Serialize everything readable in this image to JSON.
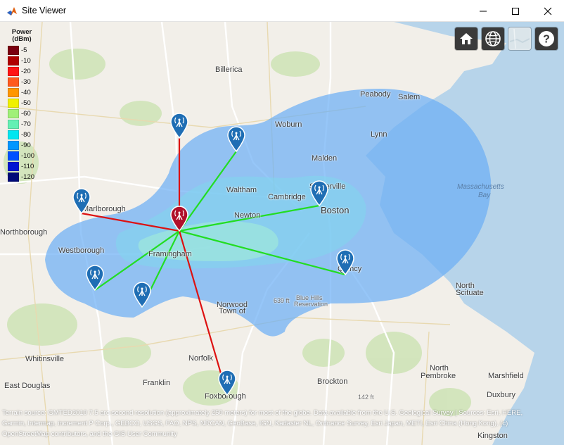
{
  "window": {
    "title": "Site Viewer",
    "app_icon": "matlab-icon",
    "buttons": [
      "minimize-icon",
      "maximize-icon",
      "close-icon"
    ]
  },
  "legend": {
    "title": "Power",
    "units": "(dBm)",
    "entries": [
      {
        "label": "-5",
        "color": "#7a0010"
      },
      {
        "label": "-10",
        "color": "#b00000"
      },
      {
        "label": "-20",
        "color": "#ff1414"
      },
      {
        "label": "-30",
        "color": "#ff5a1e"
      },
      {
        "label": "-40",
        "color": "#ff9600"
      },
      {
        "label": "-50",
        "color": "#f0f000"
      },
      {
        "label": "-60",
        "color": "#a0f078"
      },
      {
        "label": "-70",
        "color": "#64f0b4"
      },
      {
        "label": "-80",
        "color": "#00e6f0"
      },
      {
        "label": "-90",
        "color": "#0096ff"
      },
      {
        "label": "-100",
        "color": "#0050ff"
      },
      {
        "label": "-110",
        "color": "#0014d2"
      },
      {
        "label": "-120",
        "color": "#000a78"
      }
    ]
  },
  "controls": {
    "home": "home-icon",
    "globe": "globe-icon",
    "basemap": "basemap-icon",
    "help": "help-icon"
  },
  "colors": {
    "transmitter": "#b0102a",
    "receiver": "#1f6eb4",
    "link_success": "#22dd22",
    "link_failure": "#dd1111",
    "coverage_outer": "#6aaef5",
    "coverage_inner": "#8fe8e0"
  },
  "places": [
    {
      "name": "Billerica",
      "cls": "city"
    },
    {
      "name": "Peabody",
      "cls": "city"
    },
    {
      "name": "Salem",
      "cls": "city"
    },
    {
      "name": "Woburn",
      "cls": "city"
    },
    {
      "name": "Lynn",
      "cls": "city"
    },
    {
      "name": "Malden",
      "cls": "city"
    },
    {
      "name": "Somerville",
      "cls": "city"
    },
    {
      "name": "Waltham",
      "cls": "city"
    },
    {
      "name": "Cambridge",
      "cls": "city"
    },
    {
      "name": "Boston",
      "cls": "big"
    },
    {
      "name": "Newton",
      "cls": "city"
    },
    {
      "name": "Marlborough",
      "cls": "city"
    },
    {
      "name": "Northborough",
      "cls": "city"
    },
    {
      "name": "Westborough",
      "cls": "city"
    },
    {
      "name": "Framingham",
      "cls": "city"
    },
    {
      "name": "Quincy",
      "cls": "city"
    },
    {
      "name": "Norwood",
      "cls": "city"
    },
    {
      "name": "Town of",
      "cls": "city"
    },
    {
      "name": "Blue Hills",
      "cls": "small"
    },
    {
      "name": "Reservation",
      "cls": "small"
    },
    {
      "name": "North",
      "cls": "city"
    },
    {
      "name": "Scituate",
      "cls": "city"
    },
    {
      "name": "Whitinsville",
      "cls": "city"
    },
    {
      "name": "Norfolk",
      "cls": "city"
    },
    {
      "name": "Franklin",
      "cls": "city"
    },
    {
      "name": "Foxborough",
      "cls": "city"
    },
    {
      "name": "Brockton",
      "cls": "city"
    },
    {
      "name": "East Douglas",
      "cls": "city"
    },
    {
      "name": "North",
      "cls": "city"
    },
    {
      "name": "Pembroke",
      "cls": "city"
    },
    {
      "name": "Marshfield",
      "cls": "city"
    },
    {
      "name": "Duxbury",
      "cls": "city"
    },
    {
      "name": "Kingston",
      "cls": "city"
    },
    {
      "name": "Massachusetts",
      "cls": "water"
    },
    {
      "name": "Bay",
      "cls": "water"
    },
    {
      "name": "142 ft",
      "cls": "small"
    },
    {
      "name": "639 ft",
      "cls": "small"
    }
  ],
  "attribution": {
    "line1": "Terrain source: GMTED2010 7.5 arc-second resolution (approximately 250 meters) for most of the globe. Data available from the U.S. Geological Survey | Sources: Esri, HERE,",
    "line2": "Garmin, Intermap, increment P Corp., GEBCO, USGS, FAO, NPS, NRCAN, GeoBase, IGN, Kadaster NL, Ordnance Survey, Esri Japan, METI, Esri China (Hong Kong), (c)",
    "line3": "OpenStreetMap contributors, and the GIS User Community"
  }
}
